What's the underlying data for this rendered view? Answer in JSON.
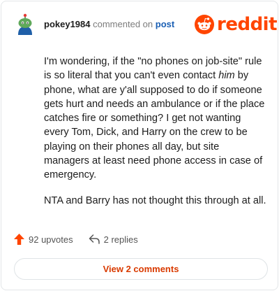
{
  "header": {
    "username": "pokey1984",
    "action_text": "commented on",
    "post_link": "post"
  },
  "logo": {
    "wordmark": "reddit",
    "brand_color": "#ff4500"
  },
  "comment": {
    "paragraph1_before": "I'm wondering, if the \"no phones on job-site\" rule is so literal that you can't even contact ",
    "paragraph1_emphasis": "him",
    "paragraph1_after": " by phone, what are y'all supposed to do if someone gets hurt and needs an ambulance or if the place catches fire or something? I get not wanting every Tom, Dick, and Harry on the crew to be playing on their phones all day, but site managers at least need phone access in case of emergency.",
    "paragraph2": "NTA and Barry has not thought this through at all."
  },
  "actions": {
    "upvotes": "92 upvotes",
    "replies": "2 replies",
    "upvote_icon": "upvote-arrow-icon",
    "reply_icon": "reply-arrow-icon",
    "upvote_color": "#ff4500"
  },
  "footer": {
    "view_comments_label": "View 2 comments",
    "view_color": "#d93a00"
  }
}
